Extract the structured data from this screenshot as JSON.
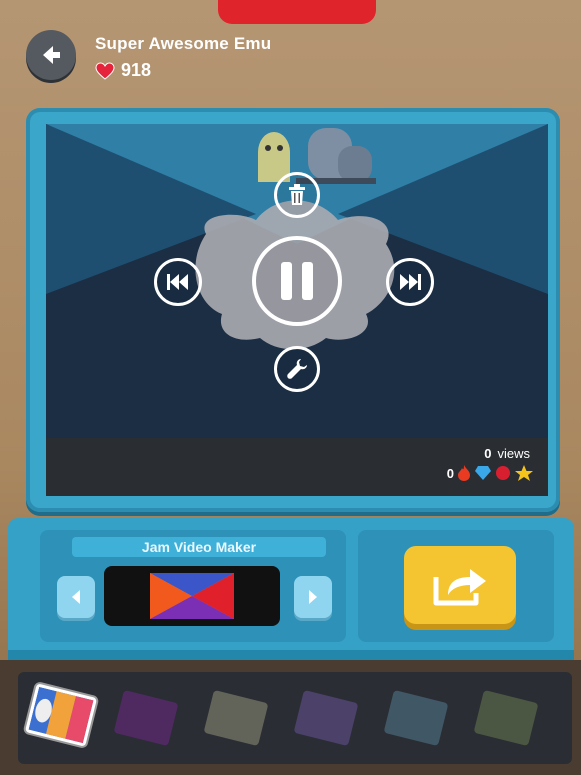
{
  "header": {
    "username": "Super Awesome Emu",
    "likes": "918"
  },
  "video": {
    "views_count": "0",
    "views_label": "views",
    "reactions_count": "0"
  },
  "maker": {
    "title": "Jam Video Maker"
  },
  "icons": {
    "back": "back-arrow-icon",
    "heart": "heart-icon",
    "delete": "trash-icon",
    "previous": "skip-back-icon",
    "pause": "pause-icon",
    "next": "skip-forward-icon",
    "edit": "wrench-icon",
    "share": "share-icon"
  },
  "colors": {
    "accent_blue": "#3aa6c9",
    "share_yellow": "#f5c531",
    "top_notch_red": "#e0242b"
  }
}
